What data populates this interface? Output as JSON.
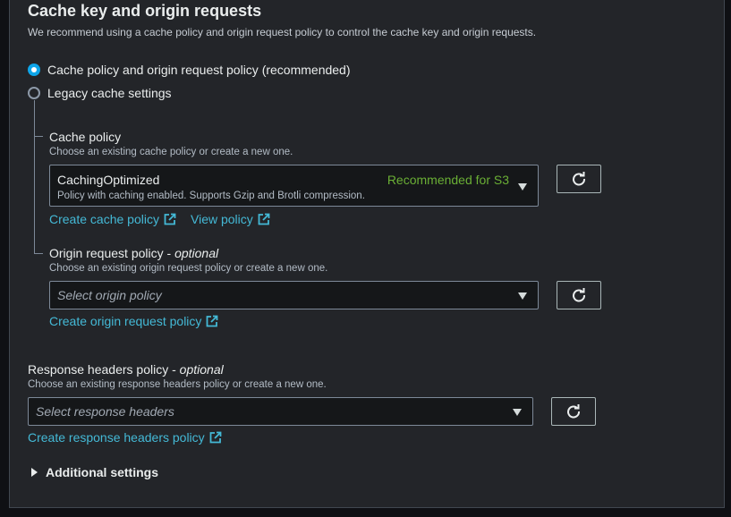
{
  "section": {
    "title": "Cache key and origin requests",
    "description": "We recommend using a cache policy and origin request policy to control the cache key and origin requests."
  },
  "options": {
    "recommended_label": "Cache policy and origin request policy (recommended)",
    "recommended_selected": true,
    "legacy_label": "Legacy cache settings",
    "legacy_selected": false
  },
  "cache_policy": {
    "label": "Cache policy",
    "hint": "Choose an existing cache policy or create a new one.",
    "selected_name": "CachingOptimized",
    "selected_description": "Policy with caching enabled. Supports Gzip and Brotli compression.",
    "selected_tag": "Recommended for S3",
    "create_link": "Create cache policy",
    "view_link": "View policy"
  },
  "origin_request_policy": {
    "label": "Origin request policy",
    "optional": "optional",
    "hint": "Choose an existing origin request policy or create a new one.",
    "placeholder": "Select origin policy",
    "create_link": "Create origin request policy"
  },
  "response_headers_policy": {
    "label": "Response headers policy",
    "optional": "optional",
    "hint": "Choose an existing response headers policy or create a new one.",
    "placeholder": "Select response headers",
    "create_link": "Create response headers policy"
  },
  "additional_settings": {
    "label": "Additional settings",
    "expanded": false
  },
  "colors": {
    "background": "#232529",
    "accent_link": "#44b9d6",
    "radio_selected": "#0ea5e9",
    "recommended_tag": "#6aaf35"
  },
  "icons": {
    "refresh": "refresh-icon",
    "external": "external-link-icon",
    "caret": "caret-down-icon",
    "expander": "caret-right-icon"
  }
}
